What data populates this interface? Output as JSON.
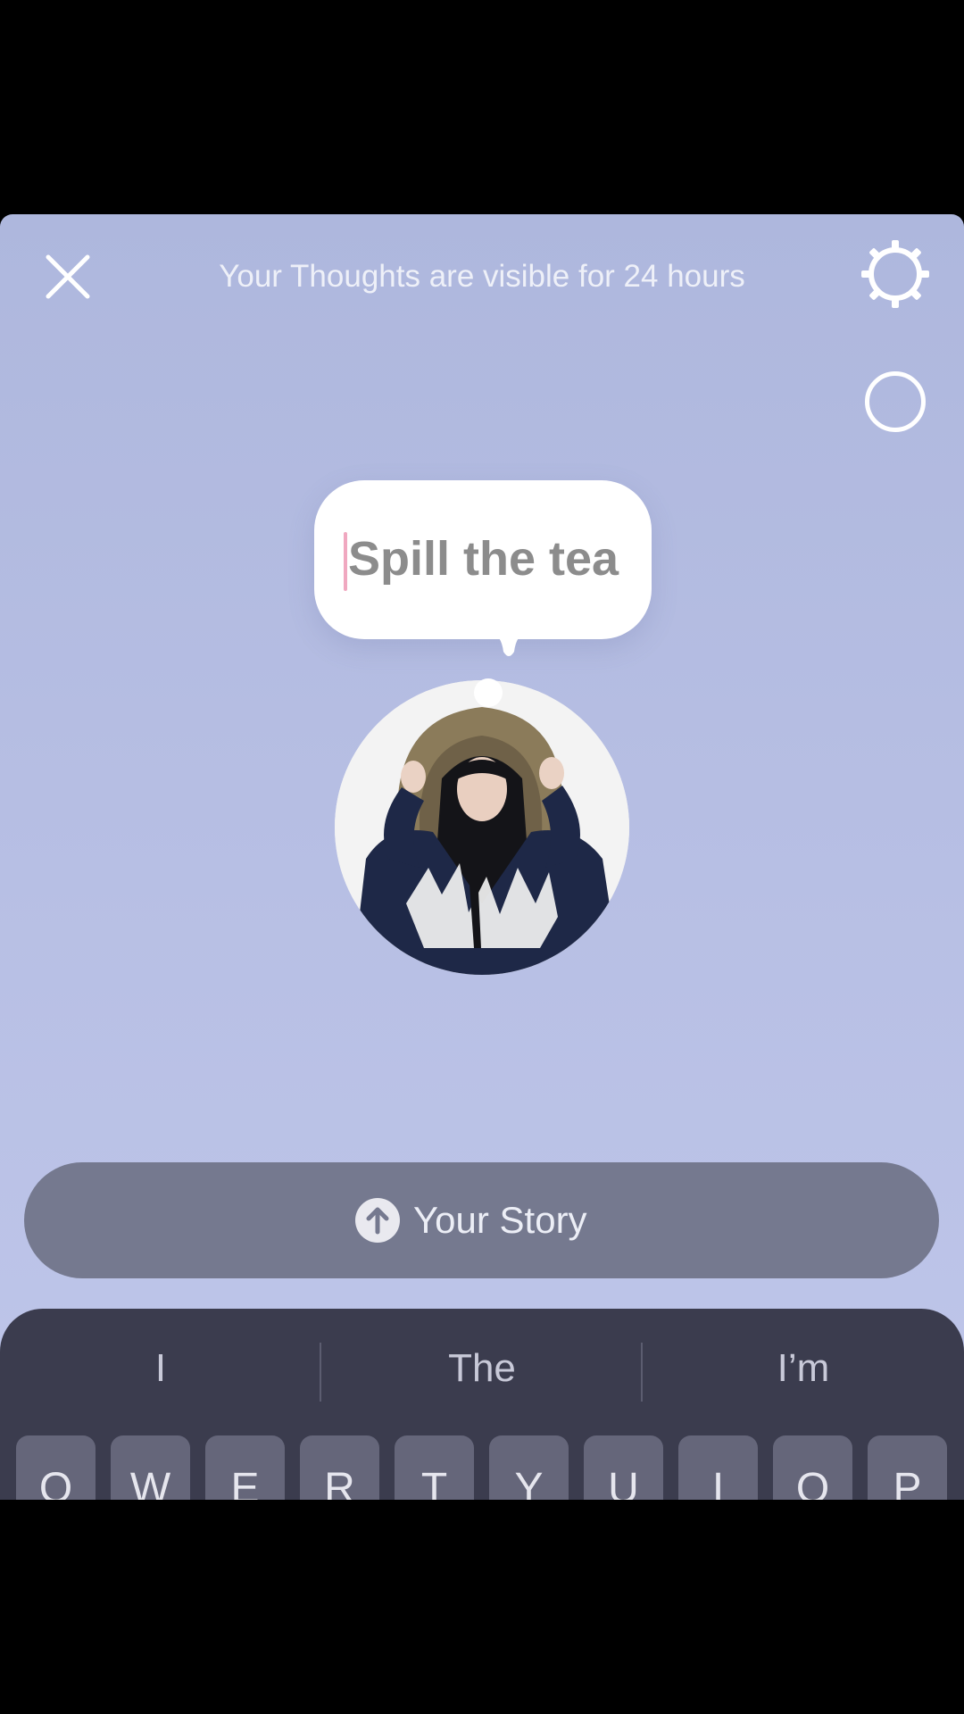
{
  "header": {
    "close_icon": "close-icon",
    "visibility_note": "Your Thoughts are visible for 24 hours",
    "settings_icon": "settings-icon"
  },
  "toggle_icon": "circle-toggle-icon",
  "thought_bubble": {
    "placeholder": "Spill the tea"
  },
  "avatar": {
    "description_icon": "profile-photo"
  },
  "share": {
    "label": "Your Story",
    "icon": "upload-arrow-icon"
  },
  "keyboard": {
    "suggestions": [
      "I",
      "The",
      "I’m"
    ],
    "row1": [
      "Q",
      "W",
      "E",
      "R",
      "T",
      "Y",
      "U",
      "I",
      "O",
      "P"
    ]
  },
  "colors": {
    "background_top": "#aeb7dd",
    "background_bottom": "#bfc6ea",
    "share_button": "#75798f",
    "keyboard": "#3b3c4e",
    "caret": "#f0a8c0"
  }
}
